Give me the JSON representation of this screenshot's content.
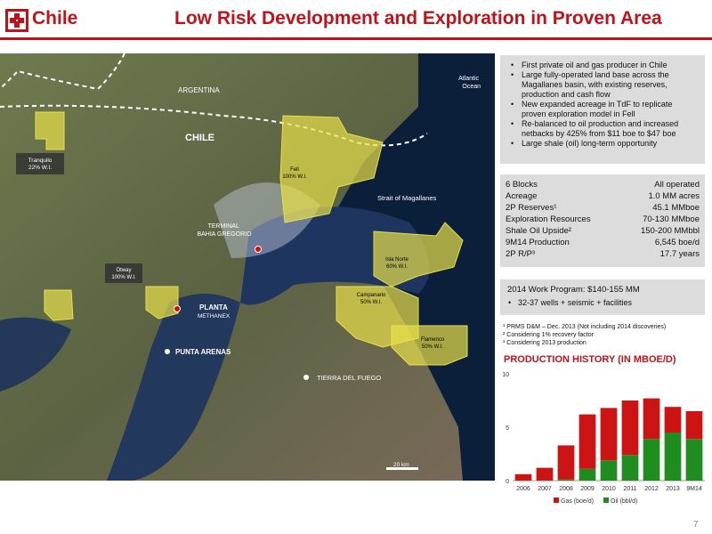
{
  "header": {
    "country": "Chile",
    "title": "Low Risk Development and Exploration in Proven Area",
    "logo_icon": "geopark-logo-icon",
    "accent_color": "#c0121a"
  },
  "map": {
    "labels": {
      "atlantic": [
        "Atlantic",
        "Ocean"
      ],
      "argentina": "ARGENTINA",
      "chile": "CHILE",
      "strait": "Strait of Magallanes",
      "terminal": [
        "TERMINAL",
        "BAHIA GREGORIO"
      ],
      "planta": "PLANTA",
      "methanex": "METHANEX",
      "punta": "PUNTA ARENAS",
      "tierra": "TIERRA DEL FUEGO",
      "scale": "20 km"
    },
    "blocks": {
      "tranquilo": [
        "Tranquilo",
        "22% W.I."
      ],
      "fell": [
        "Fell",
        "100% W.I."
      ],
      "otway": [
        "Otway",
        "100% W.I."
      ],
      "isla_norte": [
        "Isla Norte",
        "60% W.I."
      ],
      "campanario": [
        "Campanario",
        "50% W.I."
      ],
      "flamenco": [
        "Flamenco",
        "50% W.I."
      ]
    }
  },
  "bullets": [
    "First private oil and gas producer in Chile",
    "Large fully-operated land base across the",
    "Magallanes basin, with existing reserves,",
    "production and cash flow",
    "New expanded acreage in TdF to replicate",
    "proven exploration model in Fell",
    "Re-balanced to oil production and increased",
    "netbacks by 425% from $11 boe to $47 boe",
    "Large shale (oil) long-term opportunity"
  ],
  "stats": [
    {
      "label": "6 Blocks",
      "value": "All operated"
    },
    {
      "label": "Acreage",
      "value": "1.0 MM acres"
    },
    {
      "label": "2P Reserves¹",
      "value": "45.1 MMboe"
    },
    {
      "label": "Exploration Resources",
      "value": "70-130 MMboe"
    },
    {
      "label": "Shale Oil Upside²",
      "value": "150-200 MMbbl"
    },
    {
      "label": "9M14 Production",
      "value": "6,545 boe/d"
    },
    {
      "label": "2P R/P³",
      "value": "17.7 years"
    }
  ],
  "work_program": {
    "heading": "2014 Work Program: $140-155 MM",
    "sub": "32-37 wells + seismic + facilities"
  },
  "footnotes": [
    "¹ PRMS D&M – Dec. 2013 (Not including 2014 discoveries)",
    "² Considering 1% recovery factor",
    "³ Considering  2013  production"
  ],
  "production_title": "PRODUCTION HISTORY (IN MBOE/D)",
  "chart_data": {
    "type": "bar",
    "stacked": true,
    "categories": [
      "2006",
      "2007",
      "2008",
      "2009",
      "2010",
      "2011",
      "2012",
      "2013",
      "9M14"
    ],
    "series": [
      {
        "name": "Oil (bbl/d)",
        "color": "#1e8c1e",
        "values": [
          0.0,
          0.0,
          0.1,
          1.1,
          1.9,
          2.4,
          3.9,
          4.5,
          3.9
        ]
      },
      {
        "name": "Gas (boe/d)",
        "color": "#cc1414",
        "values": [
          0.6,
          1.2,
          3.2,
          5.1,
          4.9,
          5.1,
          3.8,
          2.4,
          2.6
        ]
      }
    ],
    "ylim": [
      0,
      10
    ],
    "yticks": [
      "0",
      "5",
      "10"
    ],
    "legend": "bottom"
  },
  "page_number": "7"
}
